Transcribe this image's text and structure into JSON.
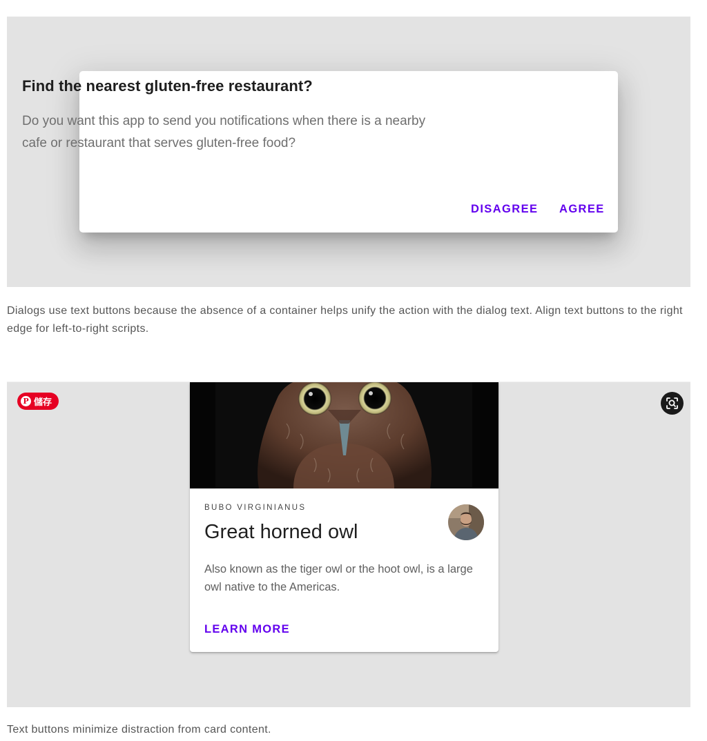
{
  "dialog": {
    "title": "Find the nearest gluten-free restaurant?",
    "body": "Do you want this app to send you notifications when there is a nearby cafe or restaurant that serves gluten-free food?",
    "disagree_label": "DISAGREE",
    "agree_label": "AGREE"
  },
  "caption1": "Dialogs use text buttons because the absence of a container helps unify the action with the dialog text. Align text buttons to the right edge for left-to-right scripts.",
  "card": {
    "overline": "BUBO VIRGINIANUS",
    "title": "Great horned owl",
    "body": "Also known as the tiger owl or the hoot owl, is a large owl native to the Americas.",
    "learn_more_label": "LEARN MORE",
    "media_icon": "owl-image",
    "avatar_icon": "person-avatar"
  },
  "pinterest": {
    "label": "儲存",
    "icon": "pinterest-icon",
    "color": "#e60023"
  },
  "lens": {
    "icon": "visual-search-icon"
  },
  "caption2": "Text buttons minimize distraction from card content.",
  "colors": {
    "accent": "#6200ee",
    "panel_bg": "#e3e3e3"
  }
}
